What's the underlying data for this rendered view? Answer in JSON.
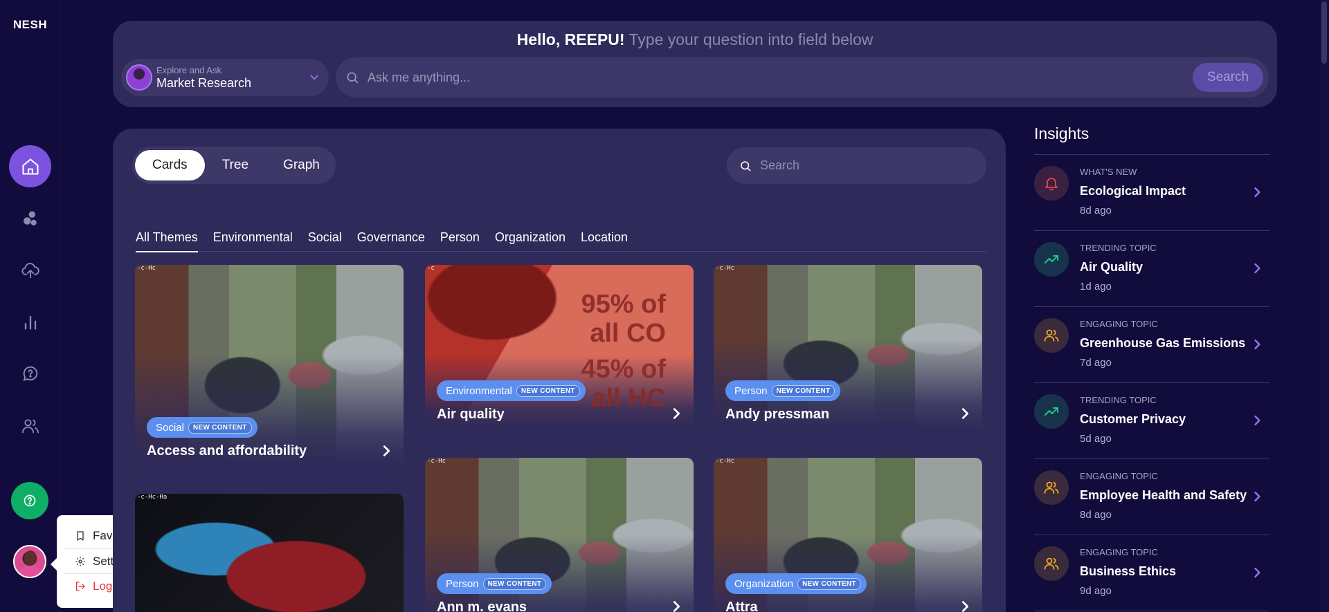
{
  "app": {
    "logo": "NESH"
  },
  "sidebar": {
    "nav": [
      {
        "name": "home",
        "icon": "home-icon",
        "active": true
      },
      {
        "name": "topics",
        "icon": "bubbles-icon"
      },
      {
        "name": "upload",
        "icon": "cloud-upload-icon"
      },
      {
        "name": "analytics",
        "icon": "bar-chart-icon"
      },
      {
        "name": "questions",
        "icon": "chat-question-icon"
      },
      {
        "name": "people",
        "icon": "users-icon"
      }
    ],
    "help_icon": "help-icon"
  },
  "user_menu": {
    "items": [
      {
        "label": "Favorites",
        "icon": "bookmark-icon"
      },
      {
        "label": "Settings",
        "icon": "gear-icon"
      },
      {
        "label": "Log out",
        "icon": "logout-icon"
      }
    ]
  },
  "ask": {
    "greeting_name": "Hello, REEPU!",
    "greeting_prompt": "Type your question into field below",
    "explore_label": "Explore and Ask",
    "explore_value": "Market Research",
    "placeholder": "Ask me anything...",
    "search_label": "Search"
  },
  "view_tabs": [
    {
      "label": "Cards",
      "active": true
    },
    {
      "label": "Tree"
    },
    {
      "label": "Graph"
    }
  ],
  "cards_search_placeholder": "Search",
  "theme_tabs": [
    {
      "label": "All Themes",
      "active": true
    },
    {
      "label": "Environmental"
    },
    {
      "label": "Social"
    },
    {
      "label": "Governance"
    },
    {
      "label": "Person"
    },
    {
      "label": "Organization"
    },
    {
      "label": "Location"
    }
  ],
  "cards": [
    {
      "tag": "Social",
      "badge": "NEW CONTENT",
      "title": "Access and affordability",
      "image": "cat-statue",
      "corner": "-c-Hc"
    },
    {
      "tag": "Environmental",
      "badge": "NEW CONTENT",
      "title": "Air quality",
      "image": "red-emissions",
      "corner": "-c",
      "image_text": [
        "95% of",
        "all CO",
        "45% of",
        "all HC"
      ]
    },
    {
      "tag": "Person",
      "badge": "NEW CONTENT",
      "title": "Andy pressman",
      "image": "cat-statue",
      "corner": "-c-Hc"
    },
    {
      "tag": "",
      "badge": "",
      "title": "",
      "image": "dark-tag",
      "corner": "-c-Hc-Ha"
    },
    {
      "tag": "Person",
      "badge": "NEW CONTENT",
      "title": "Ann m. evans",
      "image": "cat-statue",
      "corner": "-c-Hc"
    },
    {
      "tag": "Organization",
      "badge": "NEW CONTENT",
      "title": "Attra",
      "image": "cat-statue",
      "corner": "-c-Hc"
    }
  ],
  "insights": {
    "title": "Insights",
    "items": [
      {
        "kind": "WHAT'S NEW",
        "name": "Ecological Impact",
        "time": "8d ago",
        "icon": "bell-icon",
        "color": "#e5484d"
      },
      {
        "kind": "TRENDING TOPIC",
        "name": "Air Quality",
        "time": "1d ago",
        "icon": "trending-up-icon",
        "color": "#1fc98a"
      },
      {
        "kind": "ENGAGING TOPIC",
        "name": "Greenhouse Gas Emissions",
        "time": "7d ago",
        "icon": "users-icon",
        "color": "#f5a623"
      },
      {
        "kind": "TRENDING TOPIC",
        "name": "Customer Privacy",
        "time": "5d ago",
        "icon": "trending-up-icon",
        "color": "#1fc98a"
      },
      {
        "kind": "ENGAGING TOPIC",
        "name": "Employee Health and Safety",
        "time": "8d ago",
        "icon": "users-icon",
        "color": "#f5a623"
      },
      {
        "kind": "ENGAGING TOPIC",
        "name": "Business Ethics",
        "time": "9d ago",
        "icon": "users-icon",
        "color": "#f5a623"
      }
    ]
  },
  "colors": {
    "accent": "#7b53e0",
    "tag": "#5b8ff0",
    "help": "#0fae67",
    "logout": "#e53935"
  }
}
